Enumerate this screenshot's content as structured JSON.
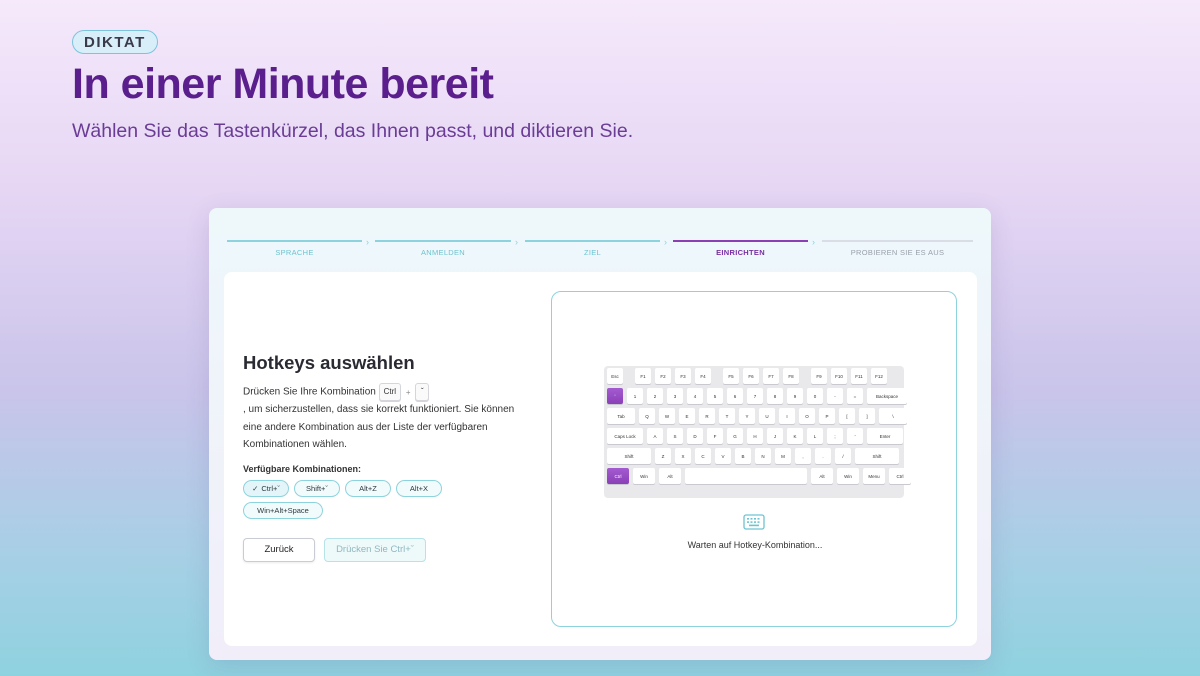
{
  "hero": {
    "badge": "DIKTAT",
    "title": "In einer Minute bereit",
    "subtitle": "Wählen Sie das Tastenkürzel, das Ihnen passt, und diktieren Sie."
  },
  "stepper": {
    "steps": [
      {
        "label": "SPRACHE",
        "state": "done"
      },
      {
        "label": "ANMELDEN",
        "state": "done"
      },
      {
        "label": "ZIEL",
        "state": "done"
      },
      {
        "label": "EINRICHTEN",
        "state": "active"
      },
      {
        "label": "PROBIEREN SIE ES AUS",
        "state": "pending"
      }
    ]
  },
  "setup": {
    "title": "Hotkeys auswählen",
    "desc_before": "Drücken Sie Ihre Kombination",
    "combo_key1": "Ctrl",
    "combo_plus": "+",
    "combo_key2": "ˇ",
    "desc_after": ", um sicherzustellen, dass sie korrekt funktioniert. Sie können eine andere Kombination aus der Liste der verfügbaren Kombinationen wählen.",
    "combinations_heading": "Verfügbare Kombinationen:",
    "combinations": [
      {
        "label": "Ctrl+ˇ",
        "selected": true
      },
      {
        "label": "Shift+ˇ",
        "selected": false
      },
      {
        "label": "Alt+Z",
        "selected": false
      },
      {
        "label": "Alt+X",
        "selected": false
      },
      {
        "label": "Win+Alt+Space",
        "selected": false
      }
    ],
    "back_label": "Zurück",
    "next_label": "Drücken Sie Ctrl+ˇ"
  },
  "keyboard_preview": {
    "status": "Warten auf Hotkey-Kombination...",
    "highlighted_keys": [
      "ˇ",
      "Ctrl"
    ],
    "icon": "keyboard-icon",
    "rows": [
      [
        "Esc",
        "F1",
        "F2",
        "F3",
        "F4",
        "F5",
        "F6",
        "F7",
        "F8",
        "F9",
        "F10",
        "F11",
        "F12"
      ],
      [
        "ˇ",
        "1",
        "2",
        "3",
        "4",
        "5",
        "6",
        "7",
        "8",
        "9",
        "0",
        "-",
        "=",
        "Backspace"
      ],
      [
        "Tab",
        "Q",
        "W",
        "E",
        "R",
        "T",
        "Y",
        "U",
        "I",
        "O",
        "P",
        "[",
        "]",
        "\\"
      ],
      [
        "Caps Lock",
        "A",
        "S",
        "D",
        "F",
        "G",
        "H",
        "J",
        "K",
        "L",
        ";",
        "'",
        "Enter"
      ],
      [
        "Shift",
        "Z",
        "X",
        "C",
        "V",
        "B",
        "N",
        "M",
        ",",
        ".",
        "/",
        "Shift"
      ],
      [
        "Ctrl",
        "Win",
        "Alt",
        "",
        "Alt",
        "Win",
        "Menu",
        "Ctrl"
      ]
    ]
  },
  "colors": {
    "brand": "#5a1f8c",
    "accent": "#8b3fb3",
    "teal": "#8dd3dd"
  }
}
